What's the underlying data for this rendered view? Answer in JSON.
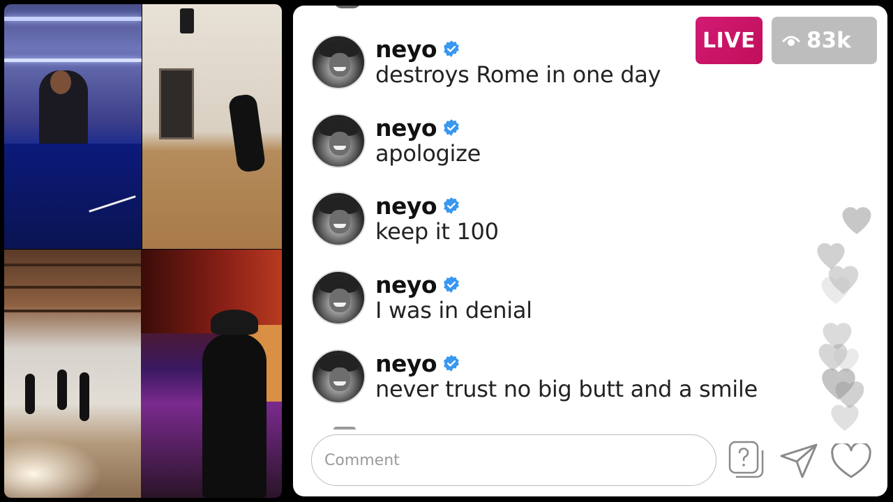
{
  "video_tiles": [
    {
      "name": "dj-set"
    },
    {
      "name": "dance-studio"
    },
    {
      "name": "dance-hall"
    },
    {
      "name": "recording-studio"
    }
  ],
  "live_badge": {
    "label": "LIVE",
    "color": "#c9136a"
  },
  "viewer_count": {
    "label": "83k",
    "icon": "eye-icon"
  },
  "comments": [
    {
      "username": "neyo",
      "verified": true,
      "text": "destroys Rome in one day"
    },
    {
      "username": "neyo",
      "verified": true,
      "text": "apologize"
    },
    {
      "username": "neyo",
      "verified": true,
      "text": "keep it 100"
    },
    {
      "username": "neyo",
      "verified": true,
      "text": "I was in denial"
    },
    {
      "username": "neyo",
      "verified": true,
      "text": "never trust no big butt and a smile"
    }
  ],
  "comment_input": {
    "placeholder": "Comment"
  },
  "actions": {
    "question_icon": "question-icon",
    "send_icon": "send-icon",
    "like_icon": "heart-icon"
  },
  "colors": {
    "verified": "#3897f0",
    "live": "#c9136a",
    "viewer_badge": "#bdbdbd"
  }
}
